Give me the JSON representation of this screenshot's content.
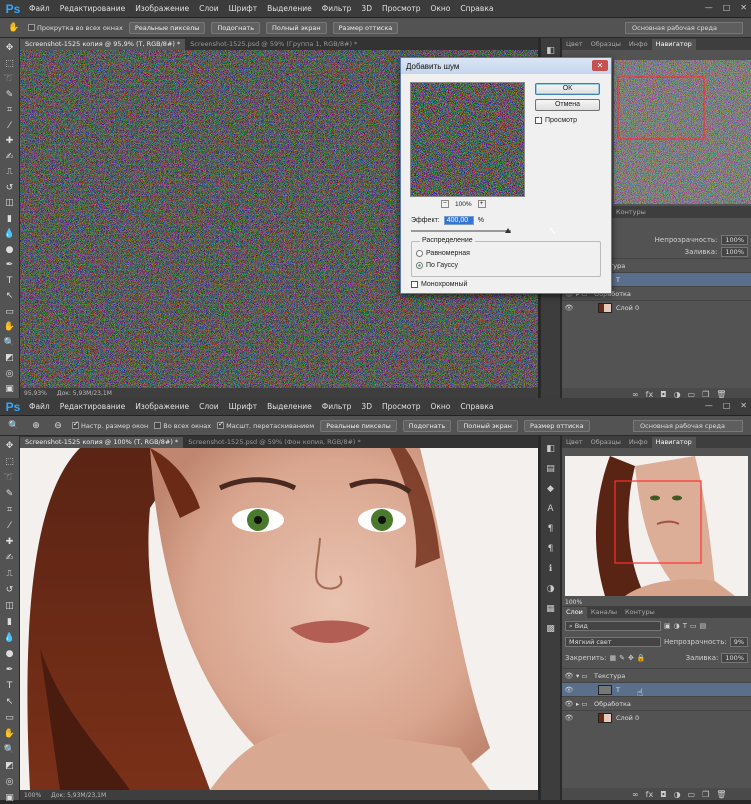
{
  "top": {
    "menu": [
      "Файл",
      "Редактирование",
      "Изображение",
      "Слои",
      "Шрифт",
      "Выделение",
      "Фильтр",
      "3D",
      "Просмотр",
      "Окно",
      "Справка"
    ],
    "options": {
      "scroll_all_label": "Прокрутка во всех окнах",
      "buttons": [
        "Реальные пикселы",
        "Подогнать",
        "Полный экран",
        "Размер оттиска"
      ],
      "workspace": "Основная рабочая среда"
    },
    "doc_tabs": [
      "Screenshot-1525 копия @ 95,9% (T, RGB/8#) *",
      "Screenshot-1525.psd @ 59% (Группа 1, RGB/8#) *"
    ],
    "status": {
      "zoom": "95,93%",
      "doc": "Док: 5,93M/23,1M"
    },
    "panel_tabs": [
      "Цвет",
      "Образцы",
      "Инфо",
      "Навигатор"
    ],
    "layers_tabs": [
      "Контуры"
    ],
    "layers": {
      "opacity_label": "Непрозрачность:",
      "opacity": "100%",
      "fill_label": "Заливка:",
      "fill": "100%",
      "rows": [
        {
          "name": "Текстура",
          "type": "group",
          "open": true
        },
        {
          "name": "T",
          "type": "layer",
          "selected": true
        },
        {
          "name": "Обработка",
          "type": "group"
        },
        {
          "name": "Слой 0",
          "type": "layer"
        }
      ]
    }
  },
  "dialog": {
    "title": "Добавить шум",
    "ok": "ОК",
    "cancel": "Отмена",
    "preview_label": "Просмотр",
    "zoom": "100%",
    "amount_label": "Эффект:",
    "amount_value": "400,00",
    "amount_unit": "%",
    "distribution_label": "Распределение",
    "uniform_label": "Равномерная",
    "gaussian_label": "По Гауссу",
    "mono_label": "Монохромный"
  },
  "bottom": {
    "menu": [
      "Файл",
      "Редактирование",
      "Изображение",
      "Слои",
      "Шрифт",
      "Выделение",
      "Фильтр",
      "3D",
      "Просмотр",
      "Окно",
      "Справка"
    ],
    "options": {
      "resize_label": "Настр. размер окон",
      "all_windows_label": "Во всех окнах",
      "scrubby_label": "Масшт. перетаскиванием",
      "buttons": [
        "Реальные пикселы",
        "Подогнать",
        "Полный экран",
        "Размер оттиска"
      ],
      "workspace": "Основная рабочая среда"
    },
    "doc_tabs": [
      "Screenshot-1525 копия @ 100% (T, RGB/8#) *",
      "Screenshot-1525.psd @ 59% (Фон копия, RGB/8#) *"
    ],
    "status": {
      "zoom": "100%",
      "doc": "Док: 5,93M/23,1M"
    },
    "panel_tabs": [
      "Цвет",
      "Образцы",
      "Инфо",
      "Навигатор"
    ],
    "nav_zoom": "100%",
    "layers_tabs": [
      "Слои",
      "Каналы",
      "Контуры"
    ],
    "layers": {
      "kind": "Вид",
      "blend": "Мягкий свет",
      "opacity_label": "Непрозрачность:",
      "opacity": "9%",
      "lock_label": "Закрепить:",
      "fill_label": "Заливка:",
      "fill": "100%",
      "rows": [
        {
          "name": "Текстура",
          "type": "group",
          "open": true
        },
        {
          "name": "T",
          "type": "layer",
          "selected": true
        },
        {
          "name": "Обработка",
          "type": "group"
        },
        {
          "name": "Слой 0",
          "type": "layer"
        }
      ]
    }
  },
  "colors": {
    "accent": "#31a8ff",
    "selected_layer": "#5a6f8c",
    "nav_frame": "#ff3030"
  }
}
